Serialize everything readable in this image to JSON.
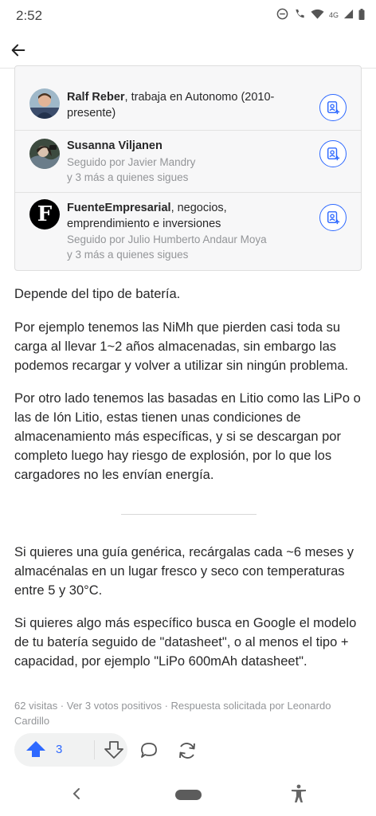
{
  "status": {
    "time": "2:52",
    "network": "4G"
  },
  "follow_list": [
    {
      "name": "Ralf Reber",
      "credential": ", trabaja en Autonomo (2010-presente)",
      "followed_by": "",
      "more": ""
    },
    {
      "name": "Susanna Viljanen",
      "credential": "",
      "followed_by": "Seguido por Javier Mandry",
      "more": "y 3 más a quienes sigues"
    },
    {
      "name": "FuenteEmpresarial",
      "credential": ", negocios, emprendimiento e inversiones",
      "followed_by": "Seguido por Julio Humberto Andaur Moya",
      "more": "y 3 más a quienes sigues",
      "avatar_letter": "F"
    }
  ],
  "answer": {
    "p1": "Depende del tipo de batería.",
    "p2": "Por ejemplo tenemos las NiMh que pierden casi toda su carga al llevar 1~2 años almacenadas, sin embargo las podemos recargar y volver a utilizar sin ningún problema.",
    "p3": "Por otro lado tenemos las basadas en Litio como las LiPo o las de Ión Litio, estas tienen unas condiciones de almacenamiento más específicas, y si se descargan por completo luego hay riesgo de explosión, por lo que los cargadores no les envían energía.",
    "p4": "Si quieres una guía genérica, recárgalas cada ~6 meses y almacénalas en un lugar fresco y seco con temperaturas entre 5 y 30°C.",
    "p5": "Si quieres algo más específico busca en Google el modelo de tu batería seguido de \"datasheet\", o al menos el tipo + capacidad, por ejemplo \"LiPo 600mAh datasheet\"."
  },
  "meta": "62 visitas · Ver 3 votos positivos · Respuesta solicitada por Leonardo Cardillo",
  "actions": {
    "upvote_count": "3"
  },
  "colors": {
    "accent": "#2e69ff",
    "text": "#282829",
    "muted": "#939598"
  }
}
